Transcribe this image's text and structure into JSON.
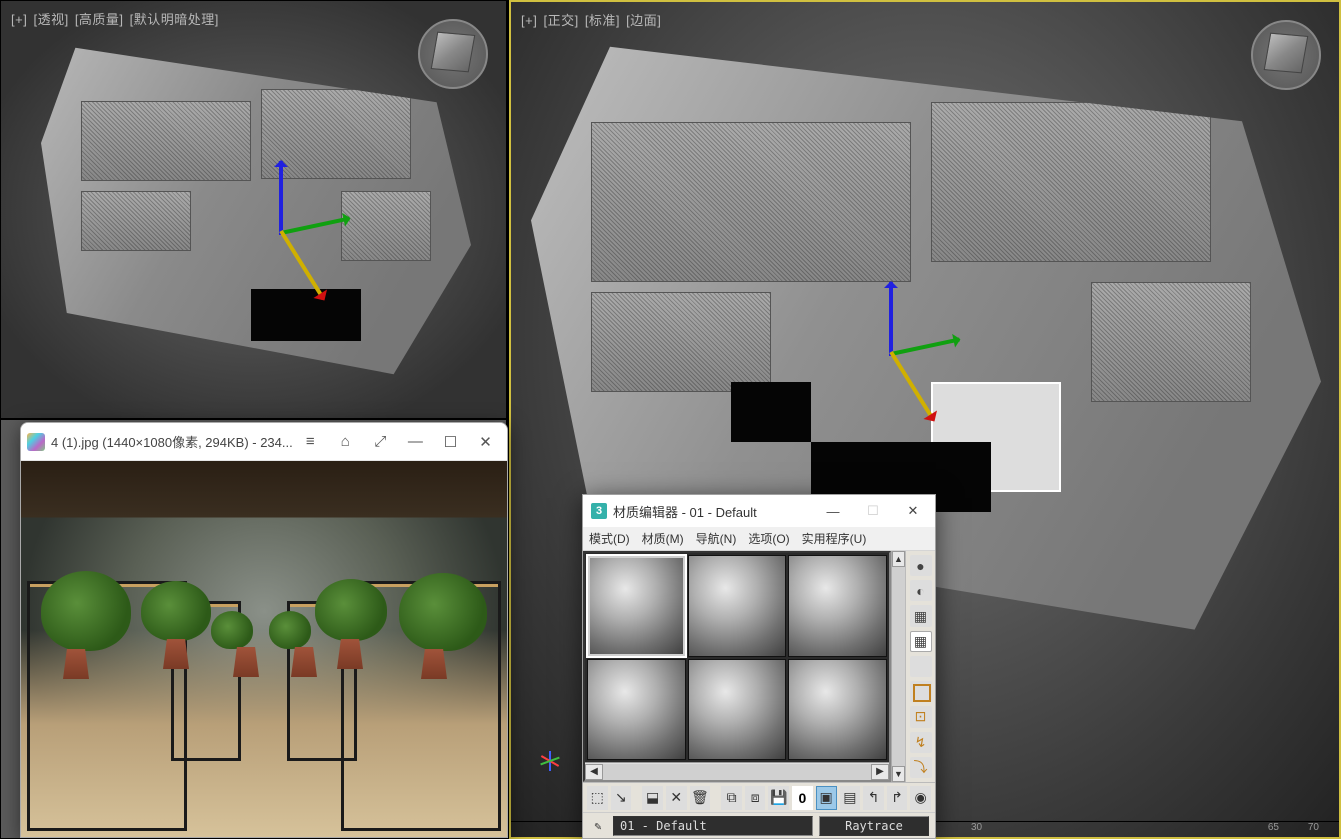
{
  "viewports": {
    "top_left": {
      "labels": [
        "[+]",
        "[透视]",
        "[高质量]",
        "[默认明暗处理]"
      ]
    },
    "right": {
      "labels": [
        "[+]",
        "[正交]",
        "[标准]",
        "[边面]"
      ]
    },
    "ruler": {
      "t1": "30",
      "t2": "65",
      "t3": "70"
    }
  },
  "image_viewer": {
    "title": "4 (1).jpg  (1440×1080像素, 294KB)  - 234...",
    "menu_glyph": "≡",
    "tab_glyph": "⌂",
    "expand_glyph": "⤢",
    "min_glyph": "—",
    "max_glyph": "☐",
    "close_glyph": "✕"
  },
  "material_editor": {
    "app_icon": "3",
    "title": "材质编辑器 - 01 - Default",
    "min_glyph": "—",
    "max_glyph": "☐",
    "close_glyph": "✕",
    "menu": {
      "mode": "模式(D)",
      "material": "材质(M)",
      "navigate": "导航(N)",
      "options": "选项(O)",
      "utilities": "实用程序(U)"
    },
    "hscroll_left": "◀",
    "hscroll_right": "▶",
    "vscroll_up": "▲",
    "vscroll_down": "▼",
    "side": {
      "sample_type": "●",
      "backlight": "◐",
      "background": "▦",
      "uv_tile": "▦",
      "video_color": "▥",
      "make_preview": "⊞",
      "options": "⊡",
      "select_by_mat": "↯",
      "mat_map_nav": "⤵"
    },
    "toolbar": {
      "get_material": "⬚",
      "put_to_scene": "↘",
      "assign_to_sel": "⬓",
      "reset": "✕",
      "delete": "🗑",
      "make_copy": "⧉",
      "make_unique": "⧈",
      "put_to_lib": "💾",
      "mat_id": "0",
      "show_map": "▣",
      "show_end": "▤",
      "go_parent": "↰",
      "go_forward": "↱",
      "pick_from_obj": "◉"
    },
    "picker_glyph": "✎",
    "material_name": "01 - Default",
    "material_type": "Raytrace"
  }
}
